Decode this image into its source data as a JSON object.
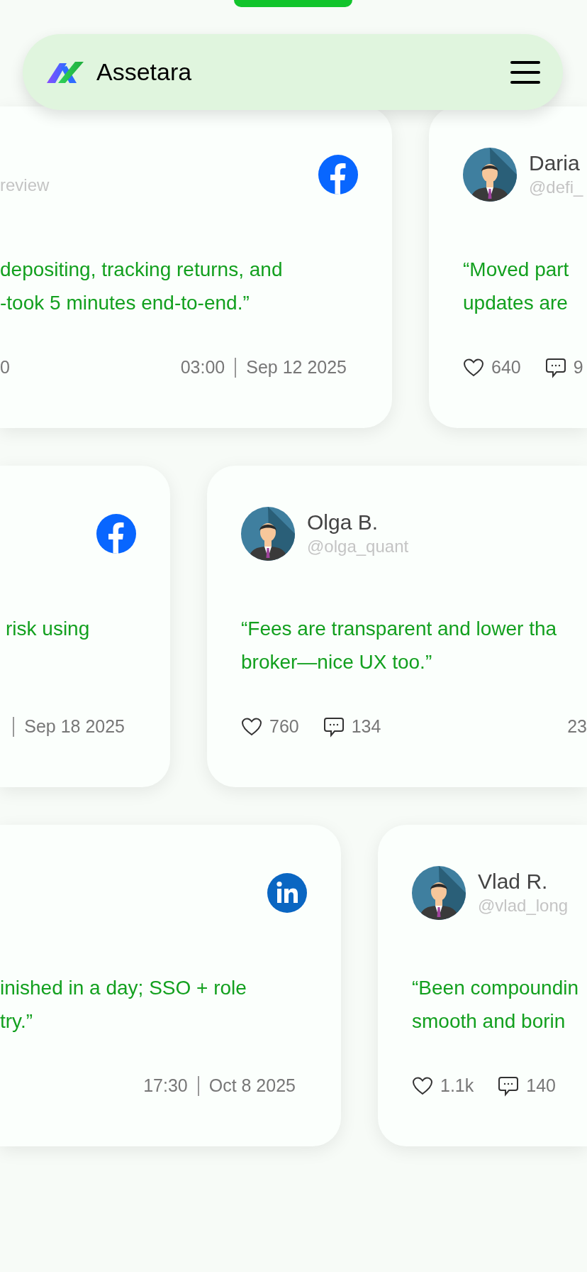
{
  "brand": {
    "name": "Assetara"
  },
  "rows": [
    {
      "cards": [
        {
          "kind": "cut-left",
          "avatar": false,
          "handle": "review",
          "social": {
            "kind": "facebook"
          },
          "quote": [
            "depositing, tracking returns, and",
            "-took 5 minutes end-to-end.”"
          ],
          "stats": [
            {
              "kind": "count",
              "value": "0"
            }
          ],
          "time": "03:00",
          "date": "Sep 12 2025"
        },
        {
          "kind": "cut-right",
          "avatar": true,
          "name": "Daria",
          "handle": "@defi_",
          "quote": [
            "“Moved part",
            "updates are"
          ],
          "stats": [
            {
              "kind": "likes",
              "value": "640"
            },
            {
              "kind": "comments",
              "value": "9"
            }
          ]
        }
      ]
    },
    {
      "cards": [
        {
          "kind": "cut-left",
          "avatar": false,
          "social": {
            "kind": "facebook"
          },
          "quote": [
            "risk using"
          ],
          "date": "Sep 18 2025"
        },
        {
          "kind": "cut-right",
          "avatar": true,
          "name": "Olga B.",
          "handle": "@olga_quant",
          "quote": [
            "“Fees are transparent and lower tha",
            "broker—nice UX too.”"
          ],
          "stats": [
            {
              "kind": "likes",
              "value": "760"
            },
            {
              "kind": "comments",
              "value": "134"
            }
          ],
          "time": "23"
        }
      ]
    },
    {
      "cards": [
        {
          "kind": "cut-left",
          "avatar": false,
          "social": {
            "kind": "linkedin"
          },
          "quote": [
            "inished in a day; SSO + role",
            "try.”"
          ],
          "time": "17:30",
          "date": "Oct 8 2025"
        },
        {
          "kind": "cut-right",
          "avatar": true,
          "name": "Vlad R.",
          "handle": "@vlad_long",
          "quote": [
            "“Been compoundin",
            "smooth and borin"
          ],
          "stats": [
            {
              "kind": "likes",
              "value": "1.1k"
            },
            {
              "kind": "comments",
              "value": "140"
            }
          ]
        }
      ]
    }
  ]
}
